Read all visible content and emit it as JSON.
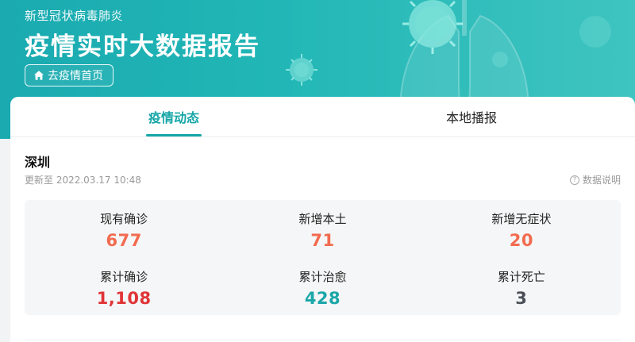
{
  "header": {
    "subtitle": "新型冠状病毒肺炎",
    "title": "疫情实时大数据报告",
    "home_button_label": "去疫情首页"
  },
  "tabs": [
    {
      "label": "疫情动态",
      "active": true
    },
    {
      "label": "本地播报",
      "active": false
    }
  ],
  "region": {
    "name": "深圳",
    "updated": "更新至 2022.03.17 10:48",
    "note_label": "数据说明"
  },
  "stats": [
    {
      "label": "现有确诊",
      "value": "677",
      "color": "#f26b4f"
    },
    {
      "label": "新增本土",
      "value": "71",
      "color": "#f26b4f"
    },
    {
      "label": "新增无症状",
      "value": "20",
      "color": "#f26b4f"
    },
    {
      "label": "累计确诊",
      "value": "1,108",
      "color": "#e03437"
    },
    {
      "label": "累计治愈",
      "value": "428",
      "color": "#1aa6a8"
    },
    {
      "label": "累计死亡",
      "value": "3",
      "color": "#4a4f57"
    }
  ],
  "colors": {
    "brand": "#1aaab0",
    "tab_active": "#16a6a8"
  },
  "icons": {
    "home": "home-icon",
    "info": "info-icon"
  }
}
